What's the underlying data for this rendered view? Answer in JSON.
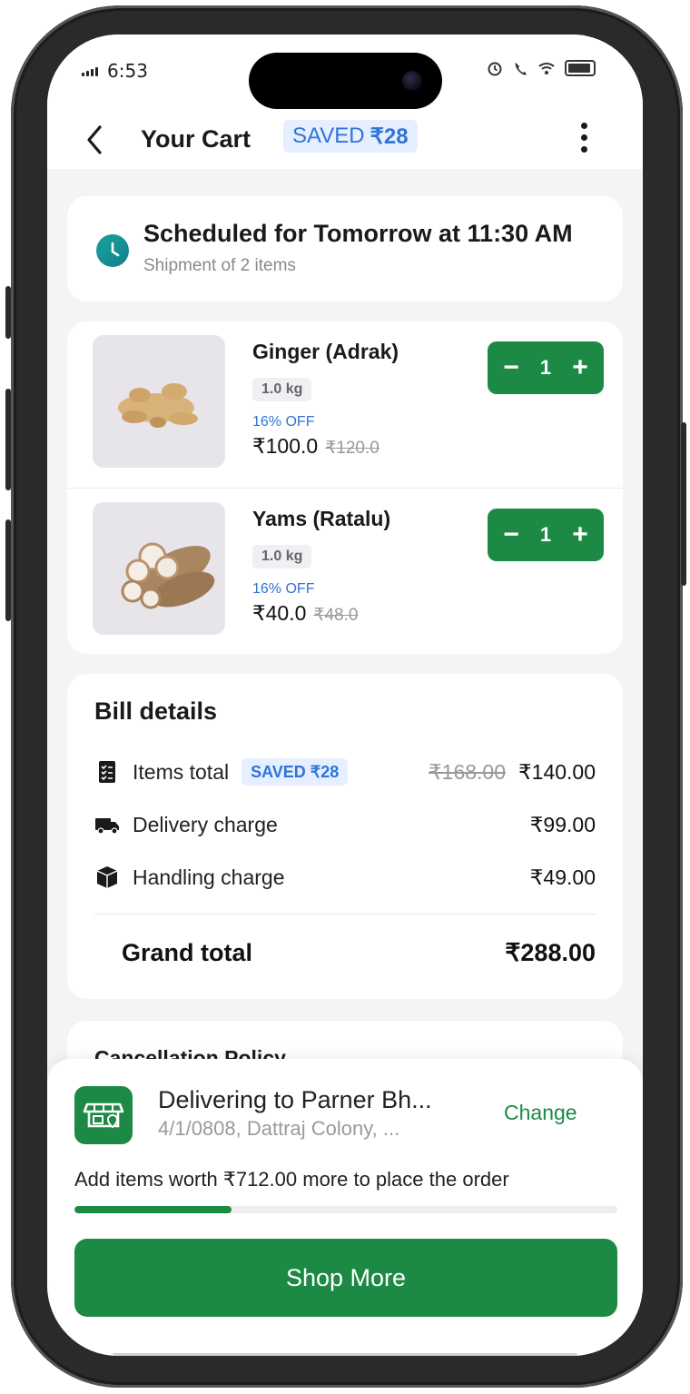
{
  "status_bar": {
    "time": "6:53"
  },
  "header": {
    "title": "Your Cart",
    "saved_label": "SAVED",
    "saved_amount": "₹28"
  },
  "schedule": {
    "title": "Scheduled for Tomorrow at 11:30 AM",
    "subtitle": "Shipment of 2 items"
  },
  "cart_items": [
    {
      "name": "Ginger (Adrak)",
      "weight": "1.0 kg",
      "discount": "16% OFF",
      "price": "₹100.0",
      "mrp": "₹120.0",
      "qty": "1"
    },
    {
      "name": "Yams (Ratalu)",
      "weight": "1.0 kg",
      "discount": "16% OFF",
      "price": "₹40.0",
      "mrp": "₹48.0",
      "qty": "1"
    }
  ],
  "bill": {
    "title": "Bill details",
    "items_total_label": "Items total",
    "items_saved": "SAVED ₹28",
    "items_total_mrp": "₹168.00",
    "items_total": "₹140.00",
    "delivery_label": "Delivery charge",
    "delivery_value": "₹99.00",
    "handling_label": "Handling charge",
    "handling_value": "₹49.00",
    "grand_label": "Grand total",
    "grand_value": "₹288.00"
  },
  "policy": {
    "title": "Cancellation Policy"
  },
  "delivery": {
    "title": "Delivering to Parner Bh...",
    "address": "4/1/0808, Dattraj Colony, ...",
    "change_label": "Change",
    "min_order_message": "Add items worth ₹712.00 more to place the order",
    "progress_fraction": 0.29,
    "cta_label": "Shop More"
  },
  "colors": {
    "brand_green": "#1c8a45",
    "accent_blue": "#2f74d9",
    "badge_bg": "#e6efff"
  },
  "icons": [
    "back-arrow-icon",
    "kebab-menu-icon",
    "clock-icon",
    "minus-icon",
    "plus-icon",
    "checklist-icon",
    "truck-icon",
    "box-icon",
    "store-icon"
  ]
}
